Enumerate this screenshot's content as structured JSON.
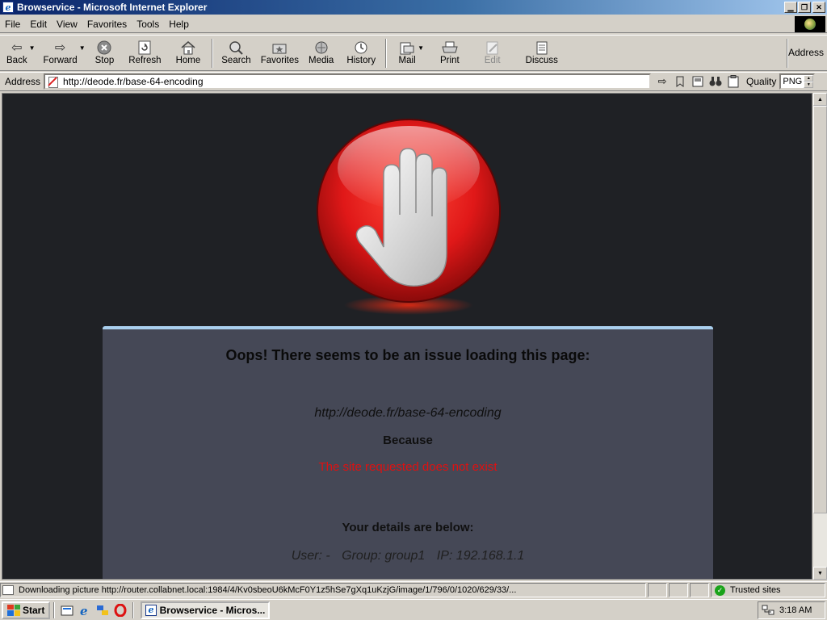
{
  "window": {
    "title": "Browservice - Microsoft Internet Explorer",
    "app_icon_glyph": "e"
  },
  "menu": [
    "File",
    "Edit",
    "View",
    "Favorites",
    "Tools",
    "Help"
  ],
  "toolbar": {
    "back": "Back",
    "forward": "Forward",
    "stop": "Stop",
    "refresh": "Refresh",
    "home": "Home",
    "search": "Search",
    "favorites": "Favorites",
    "media": "Media",
    "history": "History",
    "mail": "Mail",
    "print": "Print",
    "edit": "Edit",
    "discuss": "Discuss",
    "address_label": "Address"
  },
  "address_bar": {
    "label": "Address",
    "url": "http://deode.fr/base-64-encoding",
    "quality_label": "Quality",
    "quality_value": "PNG"
  },
  "page": {
    "heading": "Oops! There seems to be an issue loading this page:",
    "url": "http://deode.fr/base-64-encoding",
    "because": "Because",
    "reason": "The site requested does not exist",
    "details_heading": "Your details are below:",
    "user": "User: -",
    "group": "Group: group1",
    "ip": "IP: 192.168.1.1"
  },
  "status": {
    "message": "Downloading picture http://router.collabnet.local:1984/4/Kv0sbeoU6kMcF0Y1z5hSe7gXq1uKzjG/image/1/796/0/1020/629/33/...",
    "zone": "Trusted sites"
  },
  "taskbar": {
    "start": "Start",
    "task_label": "Browservice - Micros...",
    "clock": "3:18 AM"
  },
  "colors": {
    "page_bg": "#1f2125",
    "card_bg": "#454856",
    "card_top_border": "#a9cfee",
    "error_red": "#e01010",
    "titlebar_start": "#0a246a",
    "titlebar_end": "#a6caf0"
  }
}
